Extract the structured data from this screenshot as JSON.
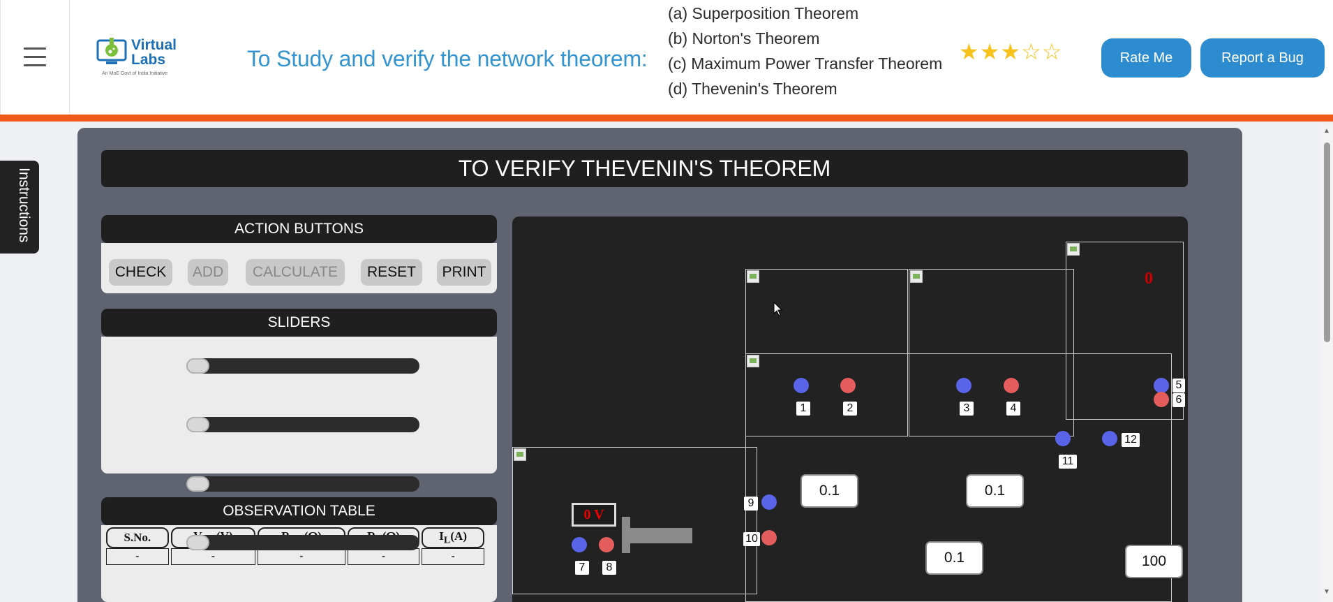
{
  "header": {
    "logo_text": "Virtual\nLabs",
    "logo_tagline": "An MoE Govt of India Initiative",
    "heading": "To Study and verify the network theorem:",
    "theorems": [
      "(a) Superposition Theorem",
      "(b) Norton's Theorem",
      "(c) Maximum Power Transfer Theorem",
      "(d) Thevenin's Theorem"
    ],
    "rating": {
      "filled_stars": 3,
      "total_stars": 5,
      "filled_glyph": "★",
      "empty_glyph": "☆"
    },
    "rate_button": "Rate Me",
    "bug_button": "Report a Bug",
    "accent_color": "#f05a1a"
  },
  "instructions_tab": "Instructions",
  "main": {
    "title": "TO VERIFY THEVENIN'S THEOREM",
    "action_panel": {
      "heading": "ACTION BUTTONS",
      "buttons": [
        {
          "label": "CHECK",
          "enabled": true
        },
        {
          "label": "ADD",
          "enabled": false
        },
        {
          "label": "CALCULATE",
          "enabled": false
        },
        {
          "label": "RESET",
          "enabled": true
        },
        {
          "label": "PRINT",
          "enabled": true
        }
      ]
    },
    "sliders_panel": {
      "heading": "SLIDERS",
      "slider_values": [
        0,
        0,
        0,
        0
      ]
    },
    "observation_table": {
      "heading": "OBSERVATION TABLE",
      "columns": [
        "S.No.",
        "V",
        "R",
        "R",
        "I"
      ],
      "column_subscripts": [
        "",
        "TH",
        "TH",
        "L",
        "L"
      ],
      "column_units": [
        "",
        "(V)",
        "(Ω)",
        "(Ω)",
        "(A)"
      ],
      "rows": [
        [
          "-",
          "-",
          "-",
          "-",
          "-"
        ]
      ]
    }
  },
  "circuit": {
    "voltage_display": "0 V",
    "meter_reading": "0",
    "terminals": [
      "1",
      "2",
      "3",
      "4",
      "5",
      "6",
      "7",
      "8",
      "9",
      "10",
      "11",
      "12"
    ],
    "values": [
      "0.1",
      "0.1",
      "0.1",
      "100"
    ]
  }
}
